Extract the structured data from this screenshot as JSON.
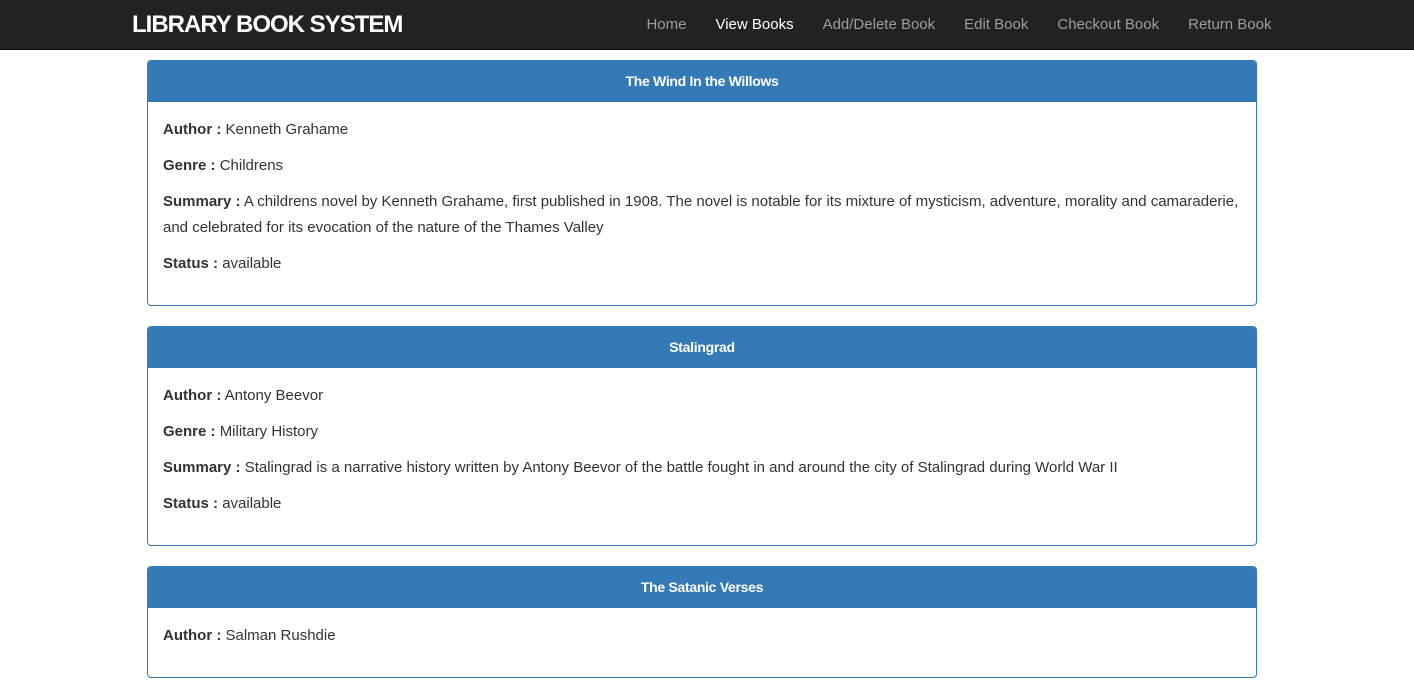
{
  "navbar": {
    "brand": "LIBRARY BOOK SYSTEM",
    "links": [
      {
        "label": "Home",
        "active": false
      },
      {
        "label": "View Books",
        "active": true
      },
      {
        "label": "Add/Delete Book",
        "active": false
      },
      {
        "label": "Edit Book",
        "active": false
      },
      {
        "label": "Checkout Book",
        "active": false
      },
      {
        "label": "Return Book",
        "active": false
      }
    ]
  },
  "labels": {
    "author": "Author :",
    "genre": "Genre :",
    "summary": "Summary :",
    "status": "Status :"
  },
  "books": [
    {
      "title": "The Wind In the Willows",
      "author": "Kenneth Grahame",
      "genre": "Childrens",
      "summary": "A childrens novel by Kenneth Grahame, first published in 1908. The novel is notable for its mixture of mysticism, adventure, morality and camaraderie, and celebrated for its evocation of the nature of the Thames Valley",
      "status": "available"
    },
    {
      "title": "Stalingrad",
      "author": "Antony Beevor",
      "genre": "Military History",
      "summary": "Stalingrad is a narrative history written by Antony Beevor of the battle fought in and around the city of Stalingrad during World War II",
      "status": "available"
    },
    {
      "title": "The Satanic Verses",
      "author": "Salman Rushdie"
    }
  ],
  "colors": {
    "navbar_bg": "#222222",
    "panel_primary": "#337ab7",
    "nav_inactive": "#9d9d9d",
    "nav_active": "#ffffff"
  }
}
